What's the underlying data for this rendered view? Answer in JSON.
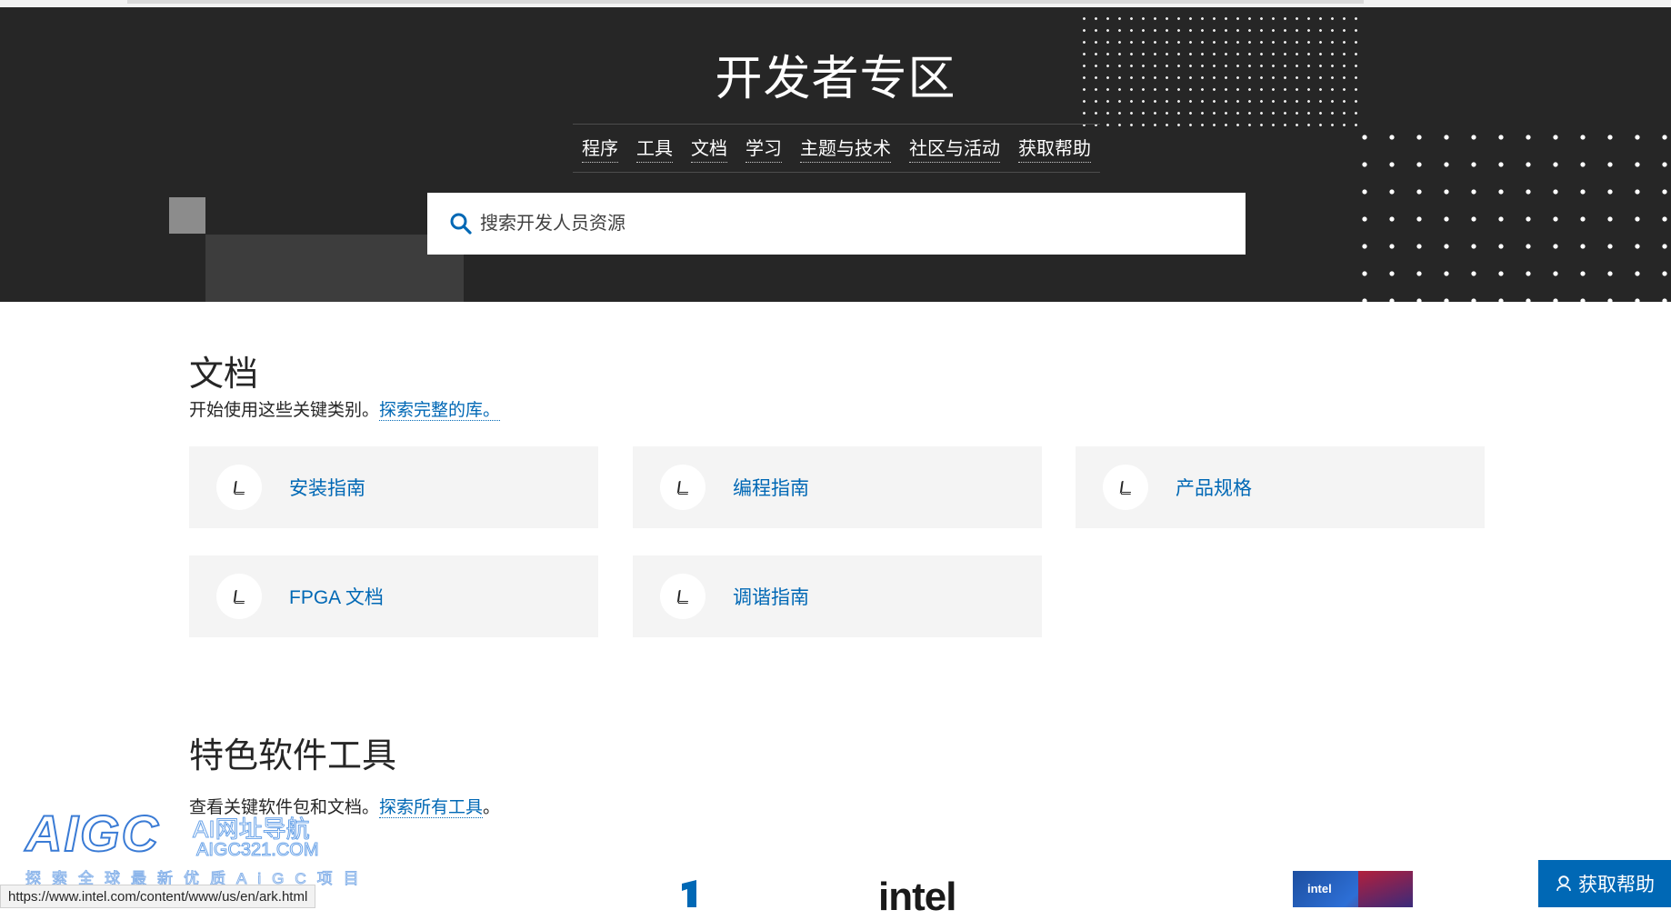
{
  "hero": {
    "title": "开发者专区",
    "nav": [
      "程序",
      "工具",
      "文档",
      "学习",
      "主题与技术",
      "社区与活动",
      "获取帮助"
    ],
    "search_placeholder": "搜索开发人员资源"
  },
  "docs": {
    "title": "文档",
    "desc": "开始使用这些关键类别。",
    "link": "探索完整的库。",
    "cards": [
      "安装指南",
      "编程指南",
      "产品规格",
      "FPGA 文档",
      "调谐指南"
    ]
  },
  "tools": {
    "title": "特色软件工具",
    "desc": "查看关键软件包和文档。",
    "link": "探索所有工具",
    "trail": "。"
  },
  "logos": {
    "intel": "intel",
    "chip": "intel"
  },
  "watermark": {
    "big": "AIGC",
    "line1": "AI网址导航",
    "line2": "AIGC321.COM",
    "line3": "探索全球最新优质AiGC项目"
  },
  "status_url": "https://www.intel.com/content/www/us/en/ark.html",
  "help_button": "获取帮助",
  "colors": {
    "hero_bg": "#262626",
    "link": "#0068b5",
    "card_bg": "#f4f4f4"
  }
}
